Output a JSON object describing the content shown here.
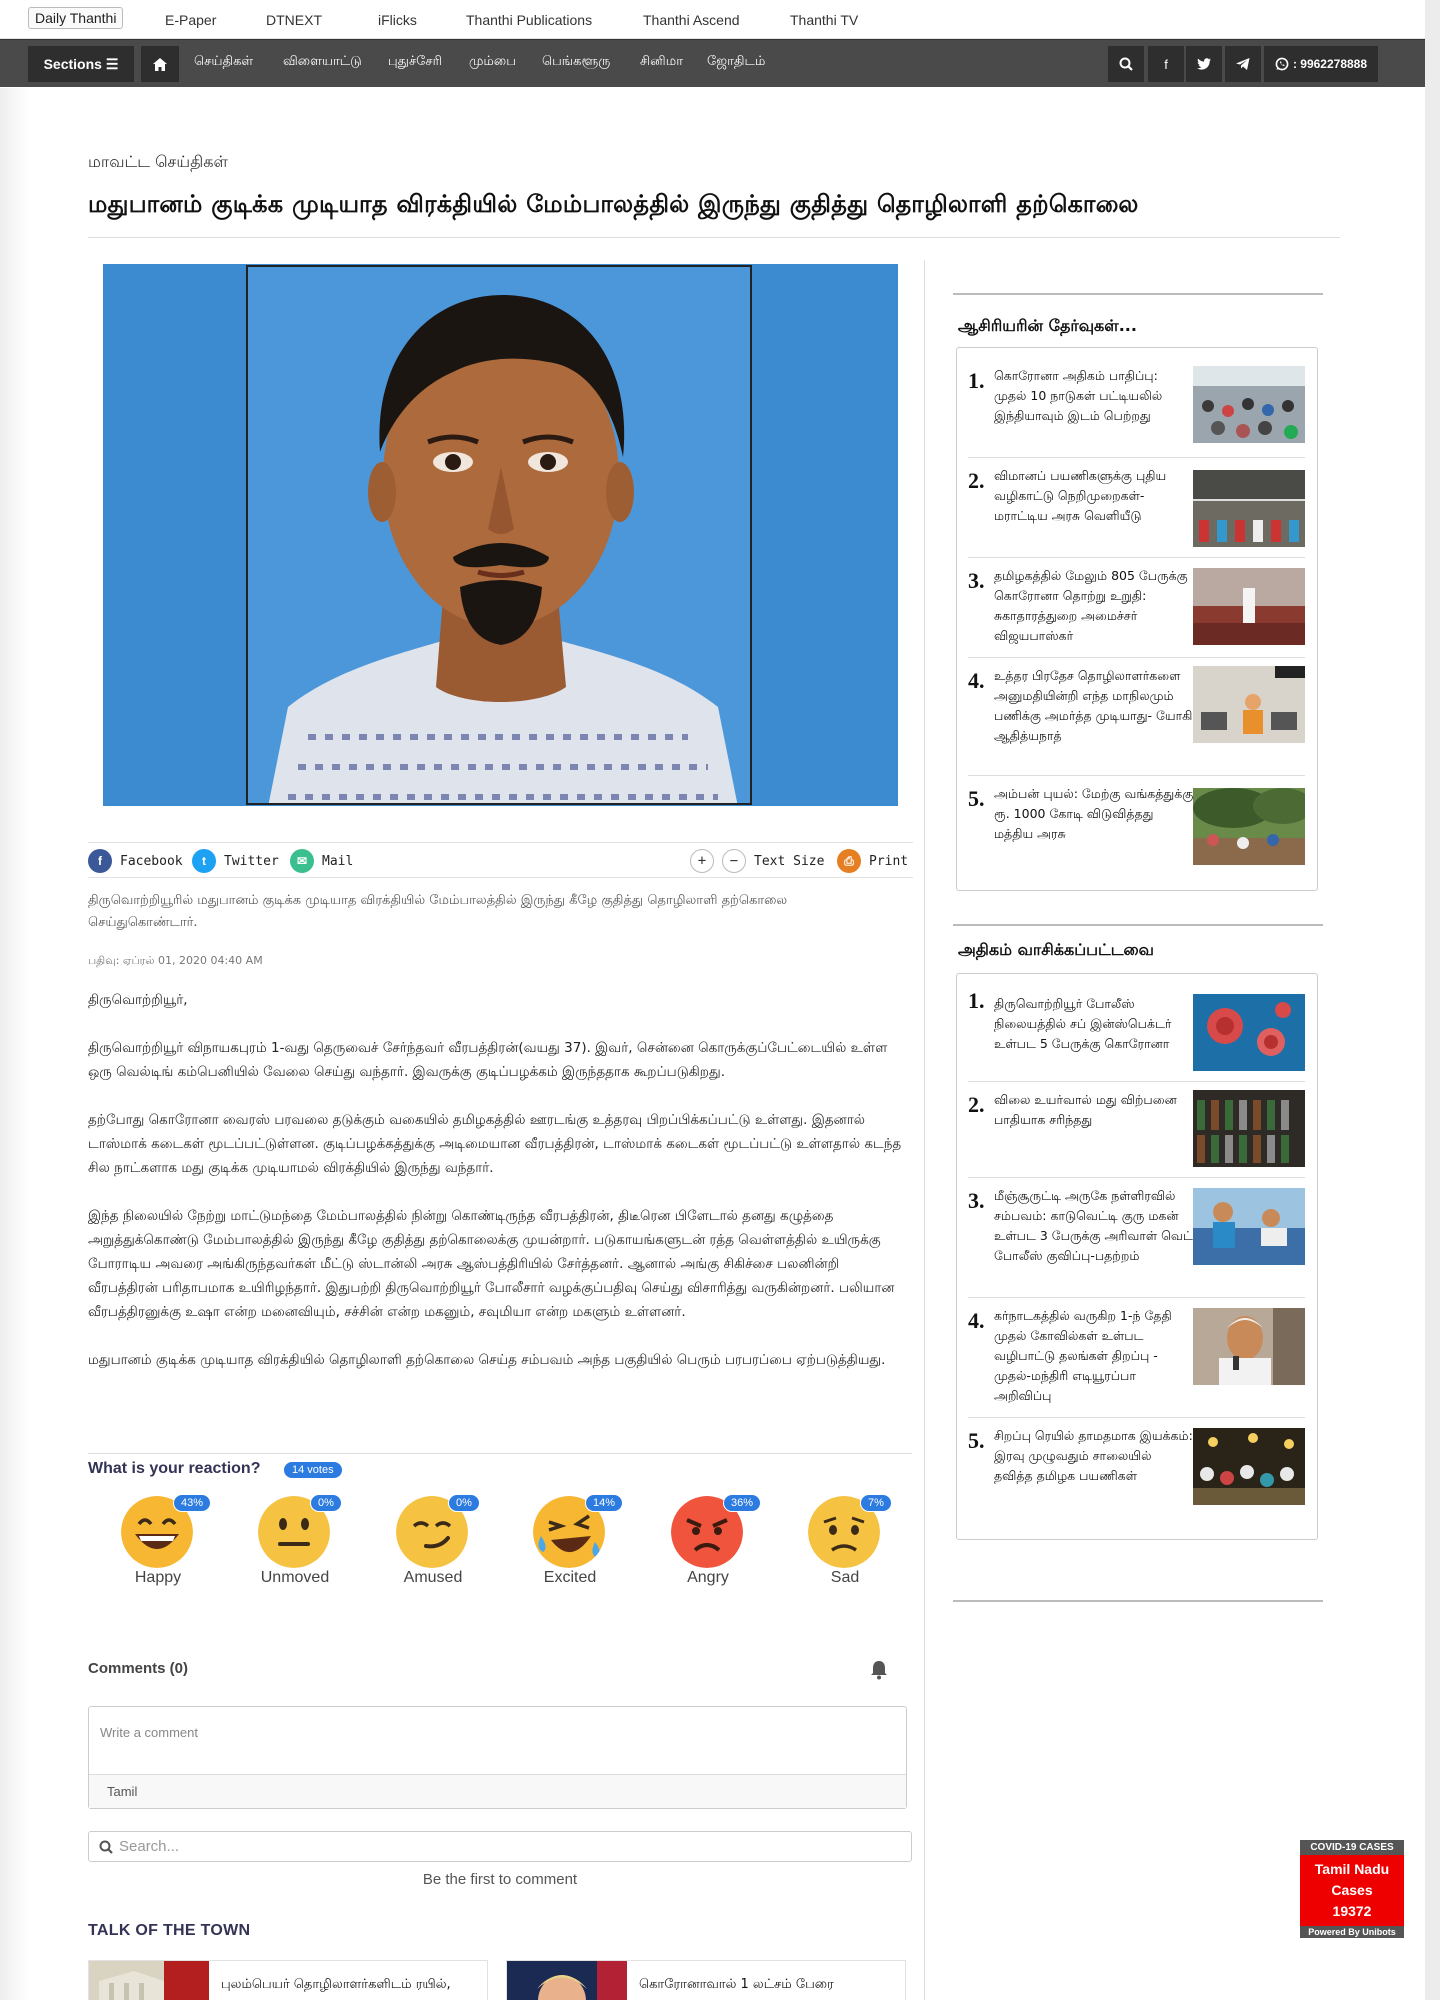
{
  "topbar": {
    "brand": "Daily Thanthi",
    "links": [
      "E-Paper",
      "DTNEXT",
      "iFlicks",
      "Thanthi Publications",
      "Thanthi Ascend",
      "Thanthi TV"
    ]
  },
  "navbar": {
    "sections_label": "Sections ☰",
    "items": [
      "செய்திகள்",
      "விளையாட்டு",
      "புதுச்சேரி",
      "மும்பை",
      "பெங்களூரு",
      "சினிமா",
      "ஜோதிடம்"
    ],
    "phone": ": 9962278888"
  },
  "article": {
    "category": "மாவட்ட செய்திகள்",
    "headline": "மதுபானம் குடிக்க முடியாத விரக்தியில் மேம்பாலத்தில் இருந்து குதித்து தொழிலாளி தற்கொலை",
    "summary": "திருவொற்றியூரில் மதுபானம் குடிக்க முடியாத விரக்தியில் மேம்பாலத்தில் இருந்து கீழே குதித்து தொழிலாளி தற்கொலை செய்துகொண்டார்.",
    "posted": "பதிவு: ஏப்ரல் 01,  2020 04:40 AM",
    "paragraphs": [
      "திருவொற்றியூர்,",
      "திருவொற்றியூர் விநாயகபுரம் 1-வது தெருவைச் சேர்ந்தவர் வீரபத்திரன்(வயது 37). இவர், சென்னை கொருக்குப்பேட்டையில் உள்ள ஒரு வெல்டிங் கம்பெனியில் வேலை செய்து வந்தார். இவருக்கு குடிப்பழக்கம் இருந்ததாக கூறப்படுகிறது.",
      "தற்போது கொரோனா வைரஸ் பரவலை தடுக்கும் வகையில் தமிழகத்தில் ஊரடங்கு உத்தரவு பிறப்பிக்கப்பட்டு உள்ளது. இதனால் டாஸ்மாக் கடைகள் மூடப்பட்டுள்ளன. குடிப்பழக்கத்துக்கு அடிமையான வீரபத்திரன், டாஸ்மாக் கடைகள் மூடப்பட்டு உள்ளதால் கடந்த சில நாட்களாக மது குடிக்க முடியாமல் விரக்தியில் இருந்து வந்தார்.",
      "இந்த நிலையில் நேற்று மாட்டுமந்தை மேம்பாலத்தில் நின்று கொண்டிருந்த வீரபத்திரன், திடீரென பிளேடால் தனது கழுத்தை அறுத்துக்கொண்டு மேம்பாலத்தில் இருந்து கீழே குதித்து தற்கொலைக்கு முயன்றார். படுகாயங்களுடன் ரத்த வெள்ளத்தில் உயிருக்கு போராடிய அவரை அங்கிருந்தவர்கள் மீட்டு ஸ்டான்லி அரசு ஆஸ்பத்திரியில் சேர்த்தனர். ஆனால் அங்கு சிகிச்சை பலனின்றி வீரபத்திரன் பரிதாபமாக உயிரிழந்தார். இதுபற்றி திருவொற்றியூர் போலீசார் வழக்குப்பதிவு செய்து விசாரித்து வருகின்றனர். பலியான வீரபத்திரனுக்கு உஷா என்ற மனைவியும், சச்சின் என்ற மகனும், சவுமியா என்ற மகளும் உள்ளனர்.",
      "மதுபானம் குடிக்க முடியாத விரக்தியில் தொழிலாளி தற்கொலை செய்த சம்பவம் அந்த பகுதியில் பெரும் பரபரப்பை ஏற்படுத்தியது."
    ]
  },
  "share": {
    "facebook": "Facebook",
    "twitter": "Twitter",
    "mail": "Mail",
    "text_size": "Text Size",
    "print": "Print"
  },
  "reactions": {
    "title": "What is your reaction?",
    "votes": "14 votes",
    "items": [
      {
        "label": "Happy",
        "pct": "43%",
        "color": "#f7b733"
      },
      {
        "label": "Unmoved",
        "pct": "0%",
        "color": "#f5c242"
      },
      {
        "label": "Amused",
        "pct": "0%",
        "color": "#f5c242"
      },
      {
        "label": "Excited",
        "pct": "14%",
        "color": "#f7b733"
      },
      {
        "label": "Angry",
        "pct": "36%",
        "color": "#f0543c"
      },
      {
        "label": "Sad",
        "pct": "7%",
        "color": "#f5c242"
      }
    ]
  },
  "comments": {
    "title": "Comments (0)",
    "placeholder": "Write a comment",
    "language": "Tamil",
    "search_placeholder": "Search...",
    "empty_text": "Be the first to comment"
  },
  "talk_of_town": {
    "title": "TALK OF THE TOWN",
    "items": [
      "புலம்பெயர் தொழிலாளர்களிடம் ரயில்,",
      "கொரோனாவால் 1 லட்சம் பேரை"
    ]
  },
  "editors_picks": {
    "title": "ஆசிரியரின் தேர்வுகள்...",
    "items": [
      {
        "num": "1.",
        "text": "கொரோனா அதிகம் பாதிப்பு: முதல் 10 நாடுகள் பட்டியலில் இந்தியாவும் இடம் பெற்றது"
      },
      {
        "num": "2.",
        "text": "விமானப் பயணிகளுக்கு புதிய வழிகாட்டு நெறிமுறைகள்- மராட்டிய அரசு வெளியீடு"
      },
      {
        "num": "3.",
        "text": "தமிழகத்தில் மேலும் 805 பேருக்கு கொரோனா தொற்று உறுதி: சுகாதாரத்துறை அமைச்சர் விஜயபாஸ்கர்"
      },
      {
        "num": "4.",
        "text": "உத்தர பிரதேச தொழிலாளர்களை அனுமதியின்றி எந்த மாநிலமும் பணிக்கு அமர்த்த முடியாது- யோகி ஆதித்யநாத்"
      },
      {
        "num": "5.",
        "text": "அம்பன் புயல்: மேற்கு வங்கத்துக்கு ரூ. 1000 கோடி விடுவித்தது மத்திய அரசு"
      }
    ]
  },
  "most_read": {
    "title": "அதிகம் வாசிக்கப்பட்டவை",
    "items": [
      {
        "num": "1.",
        "text": "திருவொற்றியூர் போலீஸ் நிலையத்தில் சப் இன்ஸ்பெக்டர் உள்பட 5 பேருக்கு கொரோனா"
      },
      {
        "num": "2.",
        "text": "விலை உயர்வால் மது விற்பனை பாதியாக சரிந்தது"
      },
      {
        "num": "3.",
        "text": "மீஞ்சூருட்டி அருகே நள்ளிரவில் சம்பவம்: காடுவெட்டி குரு மகன் உள்பட 3 பேருக்கு அரிவாள் வெட்டு போலீஸ் குவிப்பு-பதற்றம்"
      },
      {
        "num": "4.",
        "text": "கர்நாடகத்தில் வருகிற 1-ந் தேதி முதல் கோவில்கள் உள்பட வழிபாட்டு தலங்கள் திறப்பு - முதல்-மந்திரி எடியூரப்பா அறிவிப்பு"
      },
      {
        "num": "5.",
        "text": "சிறப்பு ரெயில் தாமதமாக இயக்கம்: இரவு முழுவதும் சாலையில் தவித்த தமிழக பயணிகள்"
      }
    ]
  },
  "covid_widget": {
    "title": "COVID-19 CASES",
    "region": "Tamil Nadu",
    "label": "Cases",
    "count": "19372",
    "footer": "Powered By Unibots"
  }
}
